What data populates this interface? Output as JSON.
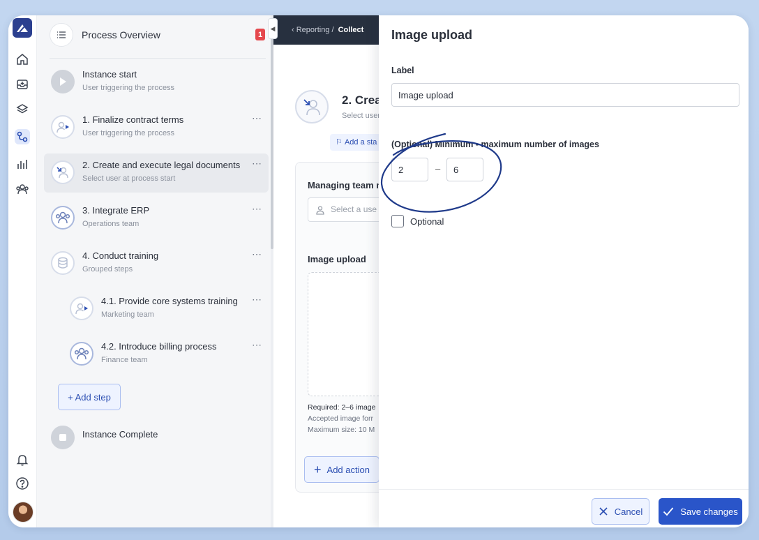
{
  "sidebar": {
    "header": {
      "title": "Process Overview",
      "badge": "1"
    },
    "steps": [
      {
        "title": "Instance start",
        "subtitle": "User triggering the process",
        "icon": "play-icon"
      },
      {
        "title": "1. Finalize contract terms",
        "subtitle": "User triggering the process",
        "icon": "user-play-icon"
      },
      {
        "title": "2. Create and execute legal documents",
        "subtitle": "Select user at process start",
        "icon": "user-assign-icon"
      },
      {
        "title": "3. Integrate ERP",
        "subtitle": "Operations team",
        "icon": "team-icon"
      },
      {
        "title": "4. Conduct training",
        "subtitle": "Grouped steps",
        "icon": "stack-icon"
      },
      {
        "title": "4.1. Provide core systems training",
        "subtitle": "Marketing team",
        "icon": "user-play-icon"
      },
      {
        "title": "4.2. Introduce billing process",
        "subtitle": "Finance team",
        "icon": "team-icon"
      },
      {
        "title": "Instance Complete",
        "subtitle": "",
        "icon": "stop-icon"
      }
    ],
    "add_step": "+ Add step",
    "more": "⋯"
  },
  "main": {
    "breadcrumb": {
      "back": "‹",
      "item1": "Reporting",
      "sep": "/",
      "item2": "Collect"
    },
    "step_title": "2. Creat",
    "step_subtitle": "Select user",
    "add_status": "Add a sta",
    "managing_team_label": "Managing team m",
    "managing_team_placeholder": "Select a use",
    "image_upload_label": "Image upload",
    "requirements": [
      "Required: 2–6 image",
      "Accepted image forr",
      "Maximum size: 10 M"
    ],
    "add_action": "Add action"
  },
  "panel": {
    "title": "Image upload",
    "label_heading": "Label",
    "label_value": "Image upload",
    "range_heading": "(Optional) Minimum - maximum number of images",
    "min_value": "2",
    "range_sep": "–",
    "max_value": "6",
    "optional_label": "Optional",
    "optional_checked": false,
    "cancel": "Cancel",
    "save": "Save changes"
  },
  "colors": {
    "accent": "#2a55c9",
    "badge": "#e5484d",
    "annotation": "#1f3a8a"
  }
}
